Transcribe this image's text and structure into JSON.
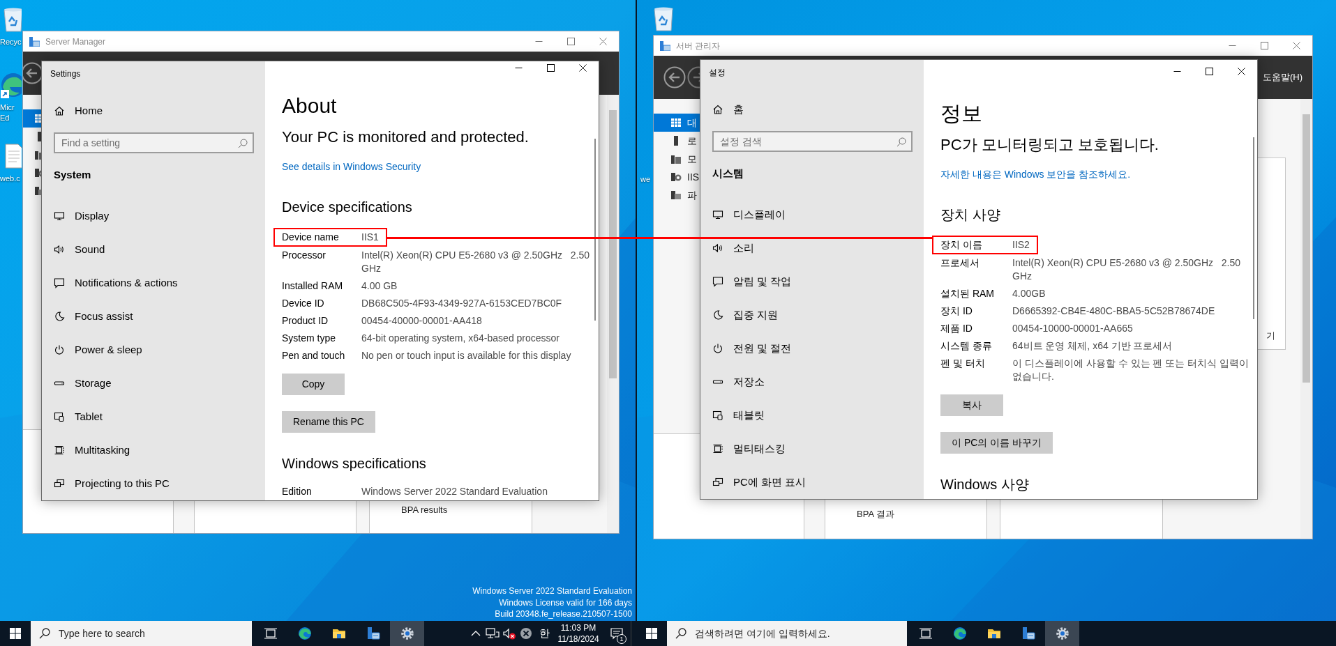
{
  "desktops": [
    {
      "desktop_icons": [
        {
          "kind": "recycle_bin",
          "label": "Recyc"
        },
        {
          "kind": "browser",
          "label": "Micr Ed"
        },
        {
          "kind": "file",
          "label": "web.c"
        }
      ],
      "server_manager": {
        "title": "Server Manager",
        "sidebar": [
          {
            "kind": "dashboard",
            "selected": true
          },
          {
            "kind": "local_server",
            "selected": false
          },
          {
            "kind": "all_servers",
            "selected": false
          },
          {
            "kind": "iis",
            "selected": false
          },
          {
            "kind": "file_services",
            "selected": false
          }
        ],
        "bpa_label": "BPA results"
      },
      "settings": {
        "title": "Settings",
        "home": "Home",
        "search_placeholder": "Find a setting",
        "section": "System",
        "nav": [
          {
            "kind": "display",
            "label": "Display"
          },
          {
            "kind": "sound",
            "label": "Sound"
          },
          {
            "kind": "notifications",
            "label": "Notifications & actions"
          },
          {
            "kind": "focus",
            "label": "Focus assist"
          },
          {
            "kind": "power",
            "label": "Power & sleep"
          },
          {
            "kind": "storage",
            "label": "Storage"
          },
          {
            "kind": "tablet",
            "label": "Tablet"
          },
          {
            "kind": "multitasking",
            "label": "Multitasking"
          },
          {
            "kind": "projecting",
            "label": "Projecting to this PC"
          }
        ],
        "heading": "About",
        "protection": "Your PC is monitored and protected.",
        "security_link": "See details in Windows Security",
        "device_heading": "Device specifications",
        "specs": [
          {
            "label": "Device name",
            "value": "IIS1",
            "annotated": true
          },
          {
            "label": "Processor",
            "value": "Intel(R) Xeon(R) CPU E5-2680 v3 @ 2.50GHz   2.50 GHz",
            "annotated": false
          },
          {
            "label": "Installed RAM",
            "value": "4.00 GB",
            "annotated": false
          },
          {
            "label": "Device ID",
            "value": "DB68C505-4F93-4349-927A-6153CED7BC0F",
            "annotated": false
          },
          {
            "label": "Product ID",
            "value": "00454-40000-00001-AA418",
            "annotated": false
          },
          {
            "label": "System type",
            "value": "64-bit operating system, x64-based processor",
            "annotated": false
          },
          {
            "label": "Pen and touch",
            "value": "No pen or touch input is available for this display",
            "annotated": false
          }
        ],
        "copy_button": "Copy",
        "rename_button": "Rename this PC",
        "windows_heading": "Windows specifications",
        "windows_specs": [
          {
            "label": "Edition",
            "value": "Windows Server 2022 Standard Evaluation",
            "annotated": false
          }
        ]
      },
      "edition_info": [
        "Windows Server 2022 Standard Evaluation",
        "Windows License valid for 166 days",
        "Build 20348.fe_release.210507-1500"
      ],
      "taskbar": {
        "search_placeholder": "Type here to search",
        "apps": [
          {
            "kind": "task_view",
            "selected": false
          },
          {
            "kind": "edge",
            "selected": false
          },
          {
            "kind": "file_explorer",
            "selected": false
          },
          {
            "kind": "server_manager",
            "selected": false
          },
          {
            "kind": "settings",
            "selected": true
          }
        ],
        "tray": {
          "icons": [
            {
              "kind": "chevron"
            },
            {
              "kind": "network"
            },
            {
              "kind": "volume_muted"
            },
            {
              "kind": "error"
            }
          ],
          "ime": "한",
          "time": "11:03 PM",
          "date": "11/18/2024",
          "notification_count": "1"
        }
      }
    },
    {
      "desktop_icons": [
        {
          "kind": "recycle_bin"
        },
        {
          "kind": "label_only",
          "label": "we"
        }
      ],
      "server_manager": {
        "title": "서버 관리자",
        "help_menu": "도움말(H)",
        "sidebar": [
          {
            "kind": "dashboard",
            "label": "대",
            "selected": true
          },
          {
            "kind": "local_server",
            "label": "로",
            "selected": false
          },
          {
            "kind": "all_servers",
            "label": "모",
            "selected": false
          },
          {
            "kind": "iis",
            "label": "IIS",
            "selected": false
          },
          {
            "kind": "file_services",
            "label": "파",
            "selected": false
          }
        ],
        "side_text": "기",
        "bpa_label": "BPA 결과"
      },
      "settings": {
        "title": "설정",
        "home": "홈",
        "search_placeholder": "설정 검색",
        "section": "시스템",
        "nav": [
          {
            "kind": "display",
            "label": "디스플레이"
          },
          {
            "kind": "sound",
            "label": "소리"
          },
          {
            "kind": "notifications",
            "label": "알림 및 작업"
          },
          {
            "kind": "focus",
            "label": "집중 지원"
          },
          {
            "kind": "power",
            "label": "전원 및 절전"
          },
          {
            "kind": "storage",
            "label": "저장소"
          },
          {
            "kind": "tablet",
            "label": "태블릿"
          },
          {
            "kind": "multitasking",
            "label": "멀티태스킹"
          },
          {
            "kind": "projecting",
            "label": "PC에 화면 표시"
          }
        ],
        "heading": "정보",
        "protection": "PC가 모니터링되고 보호됩니다.",
        "security_link": "자세한 내용은 Windows 보안을 참조하세요.",
        "device_heading": "장치 사양",
        "specs": [
          {
            "label": "장치 이름",
            "value": "IIS2",
            "annotated": true
          },
          {
            "label": "프로세서",
            "value": "Intel(R) Xeon(R) CPU E5-2680 v3 @ 2.50GHz   2.50 GHz",
            "annotated": false
          },
          {
            "label": "설치된 RAM",
            "value": "4.00GB",
            "annotated": false
          },
          {
            "label": "장치 ID",
            "value": "D6665392-CB4E-480C-BBA5-5C52B78674DE",
            "annotated": false
          },
          {
            "label": "제품 ID",
            "value": "00454-10000-00001-AA665",
            "annotated": false
          },
          {
            "label": "시스템 종류",
            "value": "64비트 운영 체제, x64 기반 프로세서",
            "annotated": false
          },
          {
            "label": "펜 및 터치",
            "value": "이 디스플레이에 사용할 수 있는 펜 또는 터치식 입력이 없습니다.",
            "annotated": false
          }
        ],
        "copy_button": "복사",
        "rename_button": "이 PC의 이름 바꾸기",
        "windows_heading": "Windows 사양"
      },
      "taskbar": {
        "search_placeholder": "검색하려면 여기에 입력하세요.",
        "apps": [
          {
            "kind": "task_view",
            "selected": false
          },
          {
            "kind": "edge",
            "selected": false
          },
          {
            "kind": "file_explorer",
            "selected": false
          },
          {
            "kind": "server_manager",
            "selected": false
          },
          {
            "kind": "settings",
            "selected": true
          }
        ]
      }
    }
  ]
}
